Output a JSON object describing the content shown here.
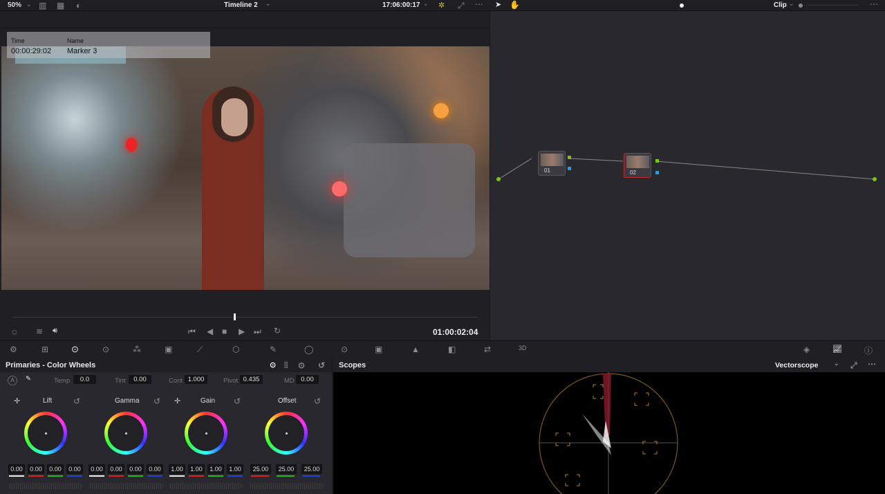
{
  "viewer": {
    "zoom": "50%",
    "timeline": "Timeline 2",
    "source_timecode": "17:06:00:17",
    "timecode": "01:00:02:04",
    "marker": {
      "time_label": "Time",
      "name_label": "Name",
      "time": "00:00:29:02",
      "name": "Marker 3"
    }
  },
  "node_editor": {
    "mode": "Clip",
    "nodes": [
      {
        "label": "01"
      },
      {
        "label": "02"
      }
    ]
  },
  "primaries": {
    "title": "Primaries - Color Wheels",
    "temp_label": "Temp",
    "temp": "0.0",
    "tint_label": "Tint",
    "tint": "0.00",
    "cont_label": "Cont",
    "cont": "1.000",
    "pivot_label": "Pivot",
    "pivot": "0.435",
    "md_label": "MD",
    "md": "0.00",
    "wheels": [
      {
        "label": "Lift",
        "values": [
          "0.00",
          "0.00",
          "0.00",
          "0.00"
        ]
      },
      {
        "label": "Gamma",
        "values": [
          "0.00",
          "0.00",
          "0.00",
          "0.00"
        ]
      },
      {
        "label": "Gain",
        "values": [
          "1.00",
          "1.00",
          "1.00",
          "1.00"
        ]
      },
      {
        "label": "Offset",
        "values": [
          "25.00",
          "25.00",
          "25.00"
        ]
      }
    ]
  },
  "scopes": {
    "title": "Scopes",
    "type": "Vectorscope"
  },
  "colors": {
    "accent_red": "#c0282c",
    "node_green": "#7ac70c",
    "node_blue": "#1ea0e6"
  }
}
